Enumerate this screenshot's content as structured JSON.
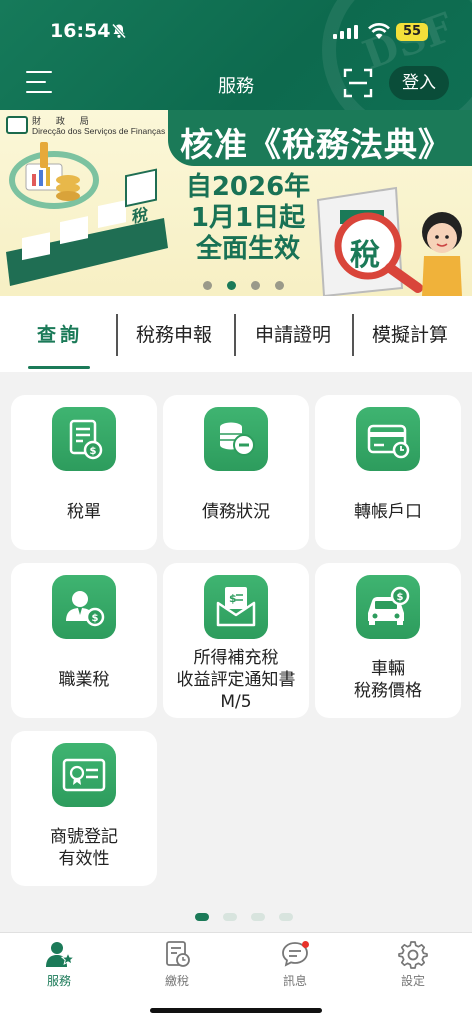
{
  "status_bar": {
    "time": "16:54",
    "battery": "55"
  },
  "header": {
    "title": "服務",
    "login_label": "登入"
  },
  "banner": {
    "org_cn": "財 政 局",
    "org_pt": "Direcção dos Serviços de Finanças",
    "title": "核准《稅務法典》",
    "sub_line1": "自2026年",
    "sub_line2": "1月1日起",
    "sub_line3": "全面生效",
    "tax_char": "稅",
    "dots_total": 4,
    "dots_active": 2
  },
  "tabs": [
    {
      "label": "查詢",
      "active": true
    },
    {
      "label": "稅務申報",
      "active": false
    },
    {
      "label": "申請證明",
      "active": false
    },
    {
      "label": "模擬計算",
      "active": false
    }
  ],
  "services": [
    {
      "label_lines": [
        "稅單"
      ],
      "icon": "tax-bill-icon"
    },
    {
      "label_lines": [
        "債務狀況"
      ],
      "icon": "debt-coins-icon"
    },
    {
      "label_lines": [
        "轉帳戶口"
      ],
      "icon": "bank-card-icon"
    },
    {
      "label_lines": [
        "職業稅"
      ],
      "icon": "professional-tax-icon"
    },
    {
      "label_lines": [
        "所得補充稅",
        "收益評定通知書",
        "M/5"
      ],
      "icon": "assessment-notice-icon"
    },
    {
      "label_lines": [
        "車輛",
        "稅務價格"
      ],
      "icon": "vehicle-icon"
    },
    {
      "label_lines": [
        "商號登記",
        "有效性"
      ],
      "icon": "business-registration-icon"
    }
  ],
  "pager": {
    "total": 4,
    "active": 1
  },
  "bottom_nav": [
    {
      "label": "服務",
      "icon": "services-icon",
      "active": true
    },
    {
      "label": "繳稅",
      "icon": "pay-tax-icon",
      "active": false
    },
    {
      "label": "訊息",
      "icon": "messages-icon",
      "active": false,
      "notification": true
    },
    {
      "label": "設定",
      "icon": "settings-icon",
      "active": false
    }
  ],
  "colors": {
    "primary": "#1b7a58",
    "icon_green": "#3fb471",
    "background": "#f2f2f2",
    "notification": "#e8322a"
  }
}
